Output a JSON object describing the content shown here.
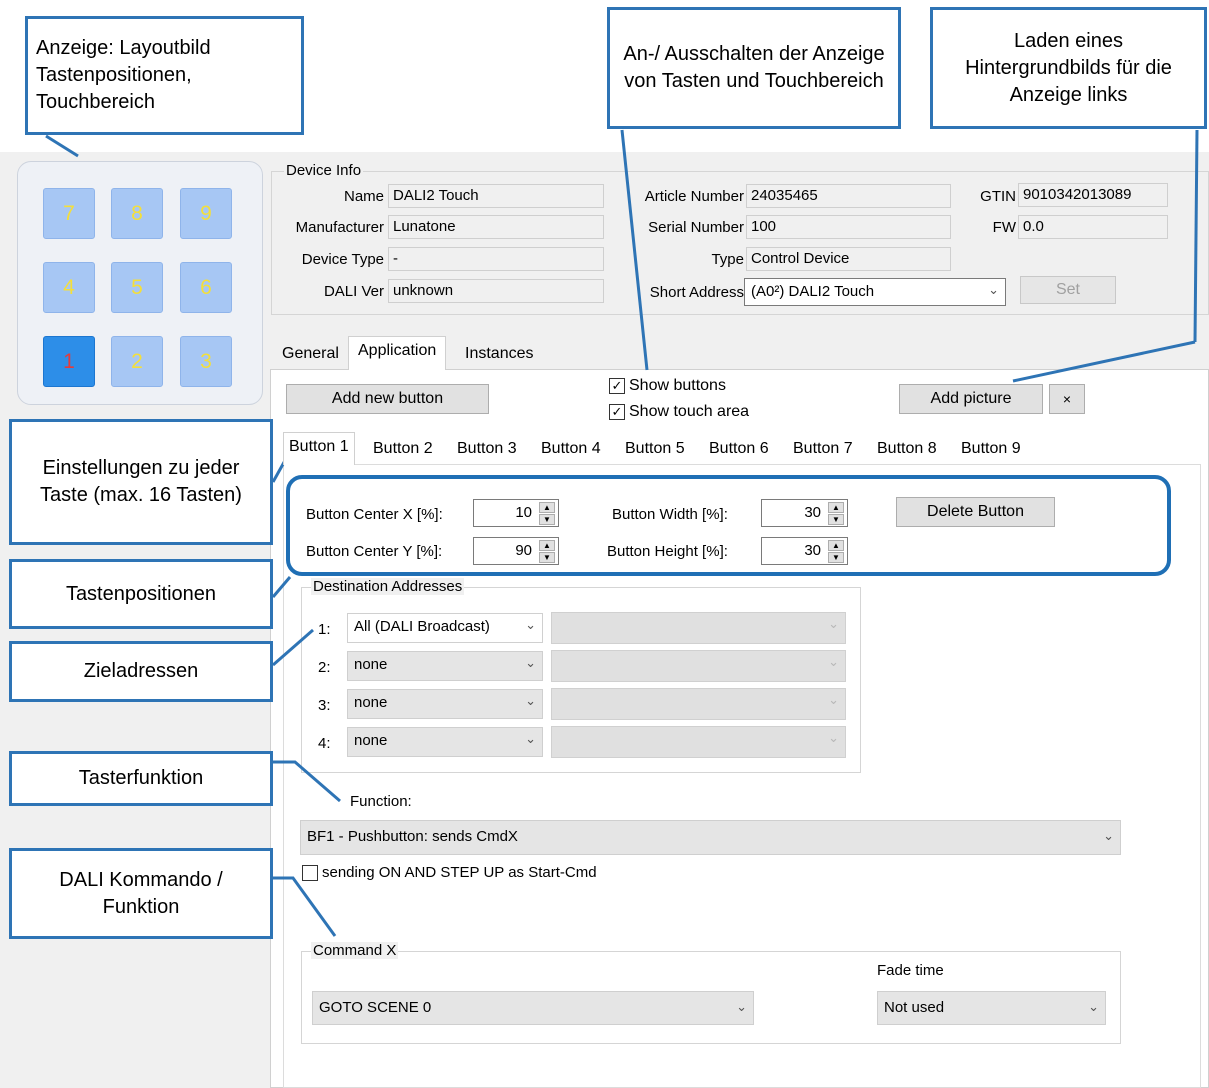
{
  "callouts": {
    "layout": "Anzeige: Layoutbild Tastenpositionen, Touchbereich",
    "toggle": "An-/ Ausschalten der Anzeige von Tasten und Touchbereich",
    "background": "Laden eines Hintergrundbilds für die Anzeige links",
    "settings": "Einstellungen zu jeder Taste (max. 16 Tasten)",
    "positions": "Tastenpositionen",
    "destinations": "Zieladressen",
    "function": "Tasterfunktion",
    "command": "DALI Kommando / Funktion"
  },
  "keypad": [
    "7",
    "8",
    "9",
    "4",
    "5",
    "6",
    "1",
    "2",
    "3"
  ],
  "device_info": {
    "title": "Device Info",
    "name_label": "Name",
    "name": "DALI2 Touch",
    "manufacturer_label": "Manufacturer",
    "manufacturer": "Lunatone",
    "device_type_label": "Device Type",
    "device_type": "-",
    "dali_ver_label": "DALI Ver",
    "dali_ver": "unknown",
    "article_label": "Article Number",
    "article": "24035465",
    "serial_label": "Serial Number",
    "serial": "100",
    "type_label": "Type",
    "type": "Control Device",
    "short_address_label": "Short Address",
    "short_address": "(A0²) DALI2 Touch",
    "gtin_label": "GTIN",
    "gtin": "9010342013089",
    "fw_label": "FW",
    "fw": "0.0",
    "set_label": "Set"
  },
  "tabs": [
    "General",
    "Application",
    "Instances"
  ],
  "application": {
    "add_button": "Add new button",
    "show_buttons": "Show buttons",
    "show_touch": "Show touch area",
    "add_picture": "Add picture",
    "clear": "×"
  },
  "button_tabs": [
    "Button 1",
    "Button 2",
    "Button 3",
    "Button 4",
    "Button 5",
    "Button 6",
    "Button 7",
    "Button 8",
    "Button 9"
  ],
  "button": {
    "center_x_label": "Button Center X [%]:",
    "center_x": "10",
    "center_y_label": "Button Center Y [%]:",
    "center_y": "90",
    "width_label": "Button Width [%]:",
    "width": "30",
    "height_label": "Button Height [%]:",
    "height": "30",
    "delete": "Delete Button"
  },
  "destinations": {
    "title": "Destination Addresses",
    "rows": [
      {
        "num": "1:",
        "value": "All (DALI Broadcast)"
      },
      {
        "num": "2:",
        "value": "none"
      },
      {
        "num": "3:",
        "value": "none"
      },
      {
        "num": "4:",
        "value": "none"
      }
    ]
  },
  "function": {
    "label": "Function:",
    "value": "BF1 - Pushbutton:  sends CmdX",
    "checkbox": "sending ON AND STEP UP as Start-Cmd"
  },
  "command": {
    "title": "Command X",
    "value": "GOTO SCENE 0",
    "fade_label": "Fade time",
    "fade_value": "Not used"
  }
}
